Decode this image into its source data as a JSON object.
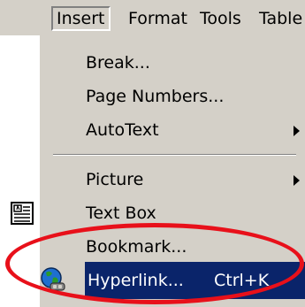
{
  "menubar": {
    "items": [
      {
        "label": "Insert",
        "active": true
      },
      {
        "label": "Format",
        "active": false
      },
      {
        "label": "Tools",
        "active": false
      },
      {
        "label": "Table",
        "active": false
      }
    ]
  },
  "insert_menu": {
    "items": [
      {
        "label": "Break...",
        "submenu": false
      },
      {
        "label": "Page Numbers...",
        "submenu": false
      },
      {
        "label": "AutoText",
        "submenu": true
      },
      {
        "label": "Picture",
        "submenu": true
      },
      {
        "label": "Text Box",
        "icon": "text-box-icon",
        "submenu": false
      },
      {
        "label": "Bookmark...",
        "submenu": false
      },
      {
        "label": "Hyperlink...",
        "icon": "hyperlink-globe-icon",
        "shortcut": "Ctrl+K",
        "submenu": false,
        "highlighted": true
      }
    ]
  },
  "colors": {
    "menu_bg": "#d4d0c8",
    "highlight_bg": "#0a246a",
    "highlight_text": "#ffffff",
    "annotation_ellipse": "#e8101a"
  }
}
